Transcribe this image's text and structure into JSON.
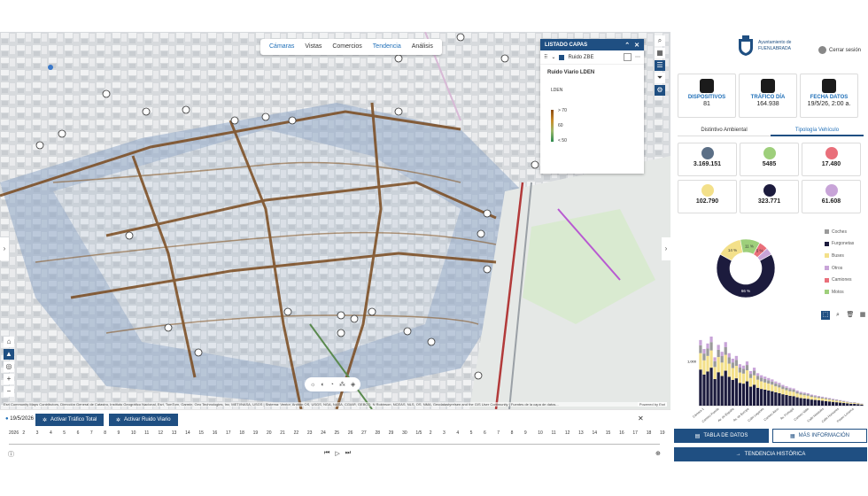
{
  "map": {
    "tabs": [
      {
        "label": "Cámaras"
      },
      {
        "label": "Vistas"
      },
      {
        "label": "Comercios"
      },
      {
        "label": "Tendencia"
      },
      {
        "label": "Análisis"
      }
    ],
    "layers_panel": {
      "title": "LISTADO CAPAS",
      "layer_name": "Ruido ZBE",
      "sublayer_title": "Ruido Viario LDEN",
      "legend_title": "LDEN",
      "legend_labels": [
        "> 70",
        "60",
        "< 50"
      ]
    },
    "attribution": "Esri Community Maps Contributors, Dirección General de Catastro, Instituto Geográfico Nacional, Esri, TomTom, Garmin, Geo Technologies, Inc, METI/NASA, USGS | Sistema: Ventor, Anthon OS, USGS, NGA, NASA, CGIAR, GEBCO, N Robinson, NCEAS, NLS, OS, NMA, Geodatastyrelsen and the GIS User Community | Fuentes de la capa de datos...",
    "powered_by": "Powered by Esri"
  },
  "timeline": {
    "date": "19/5/2026",
    "btn_total": "Activar Tráfico Total",
    "btn_ruido": "Activar Ruido Viario",
    "ticks": [
      "2026",
      "2",
      "3",
      "4",
      "5",
      "6",
      "7",
      "8",
      "9",
      "10",
      "11",
      "12",
      "13",
      "14",
      "15",
      "16",
      "17",
      "18",
      "19",
      "20",
      "21",
      "22",
      "23",
      "24",
      "25",
      "26",
      "27",
      "28",
      "29",
      "30",
      "1/5",
      "2",
      "3",
      "4",
      "5",
      "6",
      "7",
      "8",
      "9",
      "10",
      "11",
      "12",
      "13",
      "14",
      "15",
      "16",
      "17",
      "18",
      "19"
    ]
  },
  "panel": {
    "logo_line1": "Ayuntamiento de",
    "logo_line2": "FUENLABRADA",
    "logout": "Cerrar sesión",
    "kpis": [
      {
        "label": "DISPOSITIVOS",
        "value": "81",
        "icon": "camera-icon"
      },
      {
        "label": "TRÁFICO DÍA",
        "value": "164.938",
        "icon": "car-icon"
      },
      {
        "label": "FECHA DATOS",
        "value": "19/5/26, 2:00 a.",
        "icon": "calendar-icon"
      }
    ],
    "subtabs": [
      "Distintivo Ambiental",
      "Tipología Vehículo"
    ],
    "categories": [
      {
        "value": "3.169.151",
        "icon": "car-icon",
        "color": "#5b6f86"
      },
      {
        "value": "5485",
        "icon": "bus-icon",
        "color": "#9ecf7b"
      },
      {
        "value": "17.480",
        "icon": "truck-icon",
        "color": "#e96f7a"
      },
      {
        "value": "102.790",
        "icon": "van-icon",
        "color": "#f3e08a"
      },
      {
        "value": "323.771",
        "icon": "motorbike-icon",
        "color": "#1c1b3d"
      },
      {
        "value": "61.608",
        "icon": "other-vehicle-icon",
        "color": "#c8a4d8"
      }
    ],
    "donut": {
      "slices": [
        {
          "name": "Furgonetas",
          "pct": 66,
          "label": "66 %",
          "color": "#1c1b3d"
        },
        {
          "name": "Buses",
          "pct": 14,
          "label": "14 %",
          "color": "#f3e08a"
        },
        {
          "name": "Motos",
          "pct": 11,
          "label": "11 %",
          "color": "#9ecf7b"
        },
        {
          "name": "Camiones",
          "pct": 5,
          "label": "5 %",
          "color": "#e96f7a"
        },
        {
          "name": "Otros",
          "pct": 4,
          "label": "",
          "color": "#c8a4d8"
        }
      ]
    },
    "legend": [
      {
        "name": "Coches",
        "color": "#9a9a9a"
      },
      {
        "name": "Furgonetas",
        "color": "#1c1b3d"
      },
      {
        "name": "Buses",
        "color": "#f3e08a"
      },
      {
        "name": "Otros",
        "color": "#c8a4d8"
      },
      {
        "name": "Camiones",
        "color": "#e96f7a"
      },
      {
        "name": "Motos",
        "color": "#9ecf7b"
      }
    ],
    "bar_chart": {
      "ytick": "1,000",
      "values": [
        95,
        82,
        90,
        100,
        70,
        88,
        78,
        92,
        76,
        68,
        72,
        60,
        58,
        64,
        50,
        55,
        47,
        44,
        42,
        40,
        38,
        35,
        33,
        30,
        28,
        26,
        25,
        22,
        20,
        19,
        18,
        16,
        15,
        14,
        13,
        12,
        11,
        10,
        9,
        8,
        7,
        6,
        5,
        5,
        4,
        3
      ],
      "x_labels": [
        "Cámara 1",
        "Camino Fuenla",
        "Av. de España",
        "Av. de Europa",
        "Calle Leganés",
        "Camino Alcor",
        "Av. Portugal",
        "Camino Valle",
        "Calle Móstoles",
        "Calle Humanes",
        "Paseo Loranca"
      ]
    },
    "btn_tabla": "TABLA DE DATOS",
    "btn_info": "MÁS INFORMACIÓN",
    "btn_tendencia": "TENDENCIA HISTÓRICA"
  }
}
